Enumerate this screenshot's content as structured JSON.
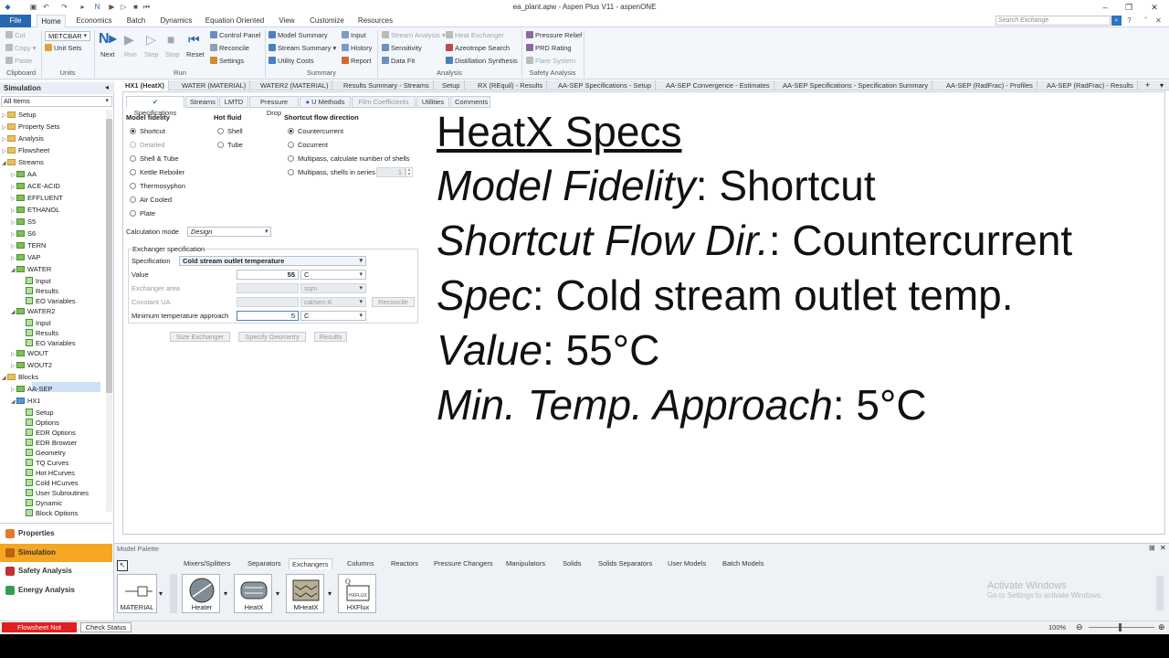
{
  "window": {
    "title": "ea_plant.apw - Aspen Plus V11 - aspenONE",
    "search_placeholder": "Search Exchange"
  },
  "menu": [
    "File",
    "Home",
    "Economics",
    "Batch",
    "Dynamics",
    "Equation Oriented",
    "View",
    "Customize",
    "Resources"
  ],
  "ribbon": {
    "clipboard": {
      "cut": "Cut",
      "copy": "Copy",
      "paste": "Paste",
      "label": "Clipboard"
    },
    "units": {
      "set": "METCBAR",
      "unit_sets": "Unit Sets",
      "label": "Units"
    },
    "run": {
      "next": "Next",
      "run": "Run",
      "step": "Step",
      "stop": "Stop",
      "reset": "Reset",
      "control_panel": "Control Panel",
      "reconcile": "Reconcile",
      "settings": "Settings",
      "label": "Run"
    },
    "summary": {
      "model_summary": "Model Summary",
      "stream_summary": "Stream Summary",
      "utility_costs": "Utility Costs",
      "input": "Input",
      "history": "History",
      "report": "Report",
      "label": "Summary"
    },
    "analysis": {
      "stream_analysis": "Stream Analysis",
      "sensitivity": "Sensitivity",
      "data_fit": "Data Fit",
      "heat_exchanger": "Heat Exchanger",
      "azeotrope_search": "Azeotrope Search",
      "distillation_synthesis": "Distillation Synthesis",
      "label": "Analysis"
    },
    "safety": {
      "pressure_relief": "Pressure Relief",
      "prd_rating": "PRD Rating",
      "flare_system": "Flare System",
      "label": "Safety Analysis"
    }
  },
  "doc_tabs": [
    "HX1 (HeatX)",
    "WATER (MATERIAL)",
    "WATER2 (MATERIAL)",
    "Results Summary - Streams",
    "Setup",
    "RX (REquil) - Results",
    "AA-SEP Specifications - Setup",
    "AA-SEP Convergence - Estimates",
    "AA-SEP Specifications - Specification Summary",
    "AA-SEP (RadFrac) - Profiles",
    "AA-SEP (RadFrac) - Results"
  ],
  "nav": {
    "header": "Simulation",
    "filter": "All Items",
    "tree": [
      {
        "t": "Setup",
        "d": 0,
        "k": "f"
      },
      {
        "t": "Property Sets",
        "d": 0,
        "k": "f"
      },
      {
        "t": "Analysis",
        "d": 0,
        "k": "f"
      },
      {
        "t": "Flowsheet",
        "d": 0,
        "k": "f"
      },
      {
        "t": "Streams",
        "d": 0,
        "k": "f"
      },
      {
        "t": "AA",
        "d": 1,
        "k": "g"
      },
      {
        "t": "ACE-ACID",
        "d": 1,
        "k": "g"
      },
      {
        "t": "EFFLUENT",
        "d": 1,
        "k": "g"
      },
      {
        "t": "ETHANOL",
        "d": 1,
        "k": "g"
      },
      {
        "t": "S5",
        "d": 1,
        "k": "g"
      },
      {
        "t": "S6",
        "d": 1,
        "k": "g"
      },
      {
        "t": "TERN",
        "d": 1,
        "k": "g"
      },
      {
        "t": "VAP",
        "d": 1,
        "k": "g"
      },
      {
        "t": "WATER",
        "d": 1,
        "k": "g"
      },
      {
        "t": "Input",
        "d": 2,
        "k": "l"
      },
      {
        "t": "Results",
        "d": 2,
        "k": "l"
      },
      {
        "t": "EO Variables",
        "d": 2,
        "k": "l"
      },
      {
        "t": "WATER2",
        "d": 1,
        "k": "g"
      },
      {
        "t": "Input",
        "d": 2,
        "k": "l"
      },
      {
        "t": "Results",
        "d": 2,
        "k": "l"
      },
      {
        "t": "EO Variables",
        "d": 2,
        "k": "l"
      },
      {
        "t": "WOUT",
        "d": 1,
        "k": "g"
      },
      {
        "t": "WOUT2",
        "d": 1,
        "k": "g"
      },
      {
        "t": "Blocks",
        "d": 0,
        "k": "f"
      },
      {
        "t": "AA-SEP",
        "d": 1,
        "k": "g"
      },
      {
        "t": "HX1",
        "d": 1,
        "k": "b"
      },
      {
        "t": "Setup",
        "d": 2,
        "k": "l"
      },
      {
        "t": "Options",
        "d": 2,
        "k": "l"
      },
      {
        "t": "EDR Options",
        "d": 2,
        "k": "l"
      },
      {
        "t": "EDR Browser",
        "d": 2,
        "k": "l"
      },
      {
        "t": "Geometry",
        "d": 2,
        "k": "l"
      },
      {
        "t": "TQ Curves",
        "d": 2,
        "k": "l"
      },
      {
        "t": "Hot HCurves",
        "d": 2,
        "k": "l"
      },
      {
        "t": "Cold HCurves",
        "d": 2,
        "k": "l"
      },
      {
        "t": "User Subroutines",
        "d": 2,
        "k": "l"
      },
      {
        "t": "Dynamic",
        "d": 2,
        "k": "l"
      },
      {
        "t": "Block Options",
        "d": 2,
        "k": "l"
      }
    ],
    "buttons": [
      "Properties",
      "Simulation",
      "Safety Analysis",
      "Energy Analysis"
    ]
  },
  "form": {
    "tabs": [
      "Specifications",
      "Streams",
      "LMTD",
      "Pressure Drop",
      "U Methods",
      "Film Coefficients",
      "Utilities",
      "Comments"
    ],
    "model_fidelity": {
      "label": "Model fidelity",
      "options": [
        "Shortcut",
        "Detailed",
        "Shell & Tube",
        "Kettle Reboiler",
        "Thermosyphon",
        "Air Cooled",
        "Plate"
      ]
    },
    "hot_fluid": {
      "label": "Hot fluid",
      "options": [
        "Shell",
        "Tube"
      ]
    },
    "flow_dir": {
      "label": "Shortcut flow direction",
      "options": [
        "Countercurrent",
        "Cocurrent",
        "Multipass, calculate number of shells",
        "Multipass, shells in series"
      ],
      "shells": "1"
    },
    "calc_mode": {
      "label": "Calculation mode",
      "value": "Design"
    },
    "exch": {
      "label": "Exchanger specification",
      "spec_label": "Specification",
      "spec_value": "Cold stream outlet temperature",
      "value_label": "Value",
      "value": "55",
      "value_unit": "C",
      "area_label": "Exchanger area",
      "area_unit": "sqm",
      "ua_label": "Constant UA",
      "ua_unit": "cal/sec-K",
      "reconcile": "Reconcile",
      "mta_label": "Minimum temperature approach",
      "mta_value": "5",
      "mta_unit": "C"
    },
    "buttons": {
      "size": "Size Exchanger",
      "geom": "Specify Geometry",
      "results": "Results"
    }
  },
  "slide": {
    "title": "HeatX Specs",
    "lines": [
      {
        "k": "Model Fidelity",
        "v": ": Shortcut"
      },
      {
        "k": "Shortcut Flow Dir.",
        "v": ": Countercurrent"
      },
      {
        "k": "Spec",
        "v": ": Cold stream outlet temp."
      },
      {
        "k": "Value",
        "v": ": 55°C"
      },
      {
        "k": "Min. Temp. Approach",
        "v": ": 5°C"
      }
    ]
  },
  "palette": {
    "header": "Model Palette",
    "tabs": [
      "Mixers/Splitters",
      "Separators",
      "Exchangers",
      "Columns",
      "Reactors",
      "Pressure Changers",
      "Manipulators",
      "Solids",
      "Solids Separators",
      "User Models",
      "Batch Models"
    ],
    "material": "MATERIAL",
    "items": [
      "Heater",
      "HeatX",
      "MHeatX",
      "HXFlux"
    ]
  },
  "watermark": {
    "title": "Activate Windows",
    "sub": "Go to Settings to activate Windows."
  },
  "status": {
    "flowsheet": "Flowsheet Not Complete",
    "check": "Check Status",
    "zoom": "100%"
  }
}
